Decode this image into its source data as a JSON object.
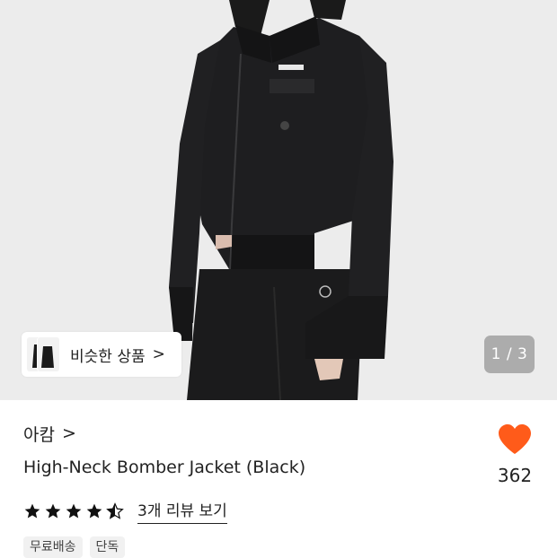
{
  "hero": {
    "similar_label": "비슷한 상품",
    "similar_chevron": ">",
    "pager": "1 / 3"
  },
  "product": {
    "brand": "아캄",
    "brand_chevron": ">",
    "title": "High-Neck Bomber Jacket (Black)",
    "rating": 4.5,
    "review_link": "3개 리뷰 보기",
    "tags": [
      "무료배송",
      "단독"
    ]
  },
  "like": {
    "count": "362",
    "color": "#ff5b1a"
  },
  "colors": {
    "background": "#ececec",
    "star": "#111111"
  }
}
